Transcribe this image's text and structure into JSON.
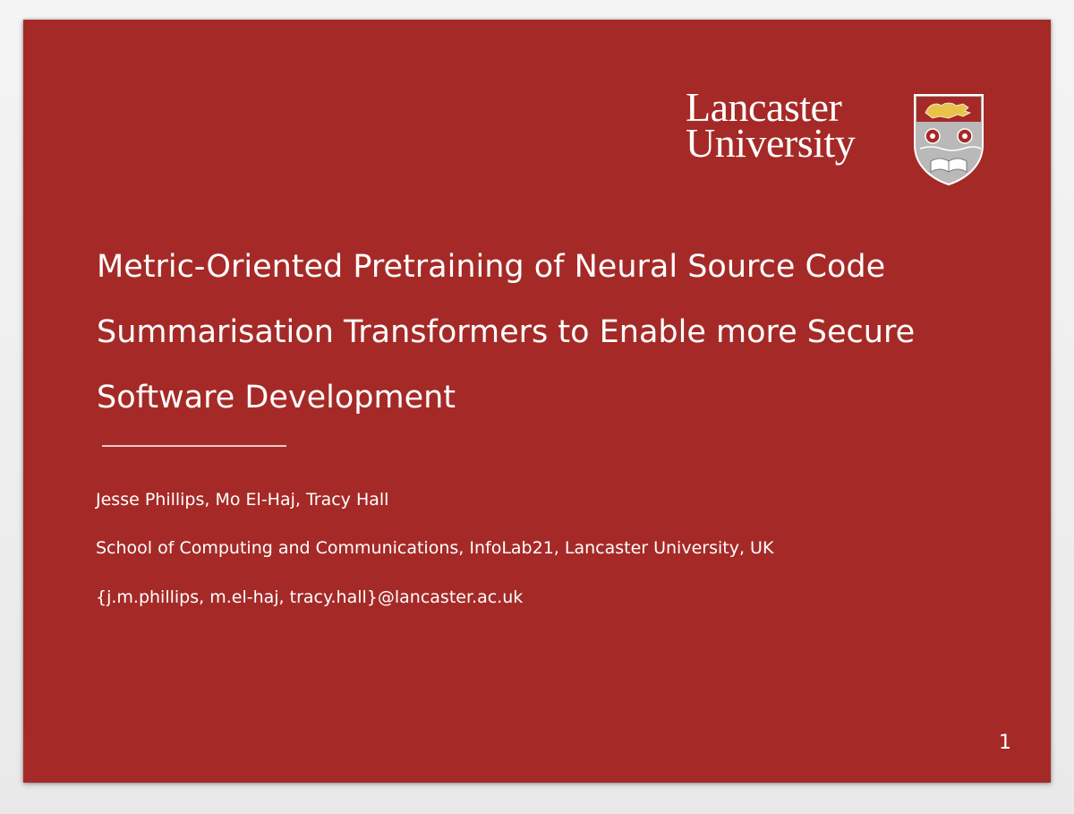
{
  "slide": {
    "background_color": "#a52a27",
    "text_color": "#ffffff",
    "logo": {
      "line1": "Lancaster",
      "line2": "University",
      "crest_icon": "lancaster-university-crest"
    },
    "title_lines": [
      "Metric-Oriented Pretraining of Neural Source Code",
      "Summarisation Transformers to Enable more Secure",
      "Software Development"
    ],
    "authors": "Jesse Phillips, Mo El-Haj, Tracy Hall",
    "affiliation": "School of Computing and Communications, InfoLab21, Lancaster University, UK",
    "emails": "{j.m.phillips, m.el-haj, tracy.hall}@lancaster.ac.uk",
    "page_number": "1"
  }
}
